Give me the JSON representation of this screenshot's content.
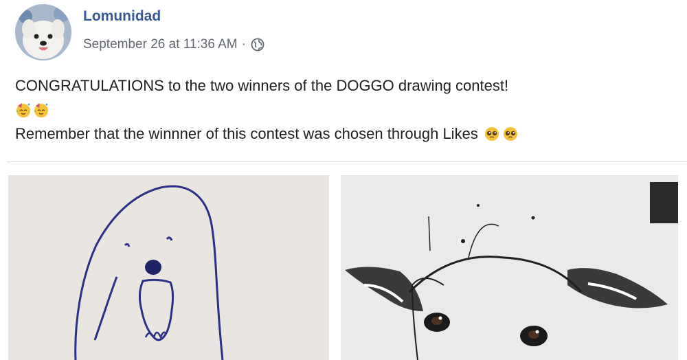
{
  "post": {
    "author": "Lomunidad",
    "timestamp": "September 26 at 11:36 AM",
    "separator": "·",
    "privacy_icon": "globe-icon",
    "line1": "CONGRATULATIONS to the two winners of the DOGGO drawing contest!",
    "line3": "Remember that the winnner of this contest was chosen through Likes",
    "emojis_line2": [
      "party-face-icon",
      "party-face-icon"
    ],
    "emojis_line3": [
      "pleading-face-icon",
      "pleading-face-icon"
    ]
  },
  "colors": {
    "author": "#385898",
    "meta": "#616770",
    "text": "#1c1e21",
    "divider": "#dddfe2"
  },
  "photos": [
    {
      "subject": "simple-dog-drawing"
    },
    {
      "subject": "ink-dog-drawing"
    }
  ]
}
